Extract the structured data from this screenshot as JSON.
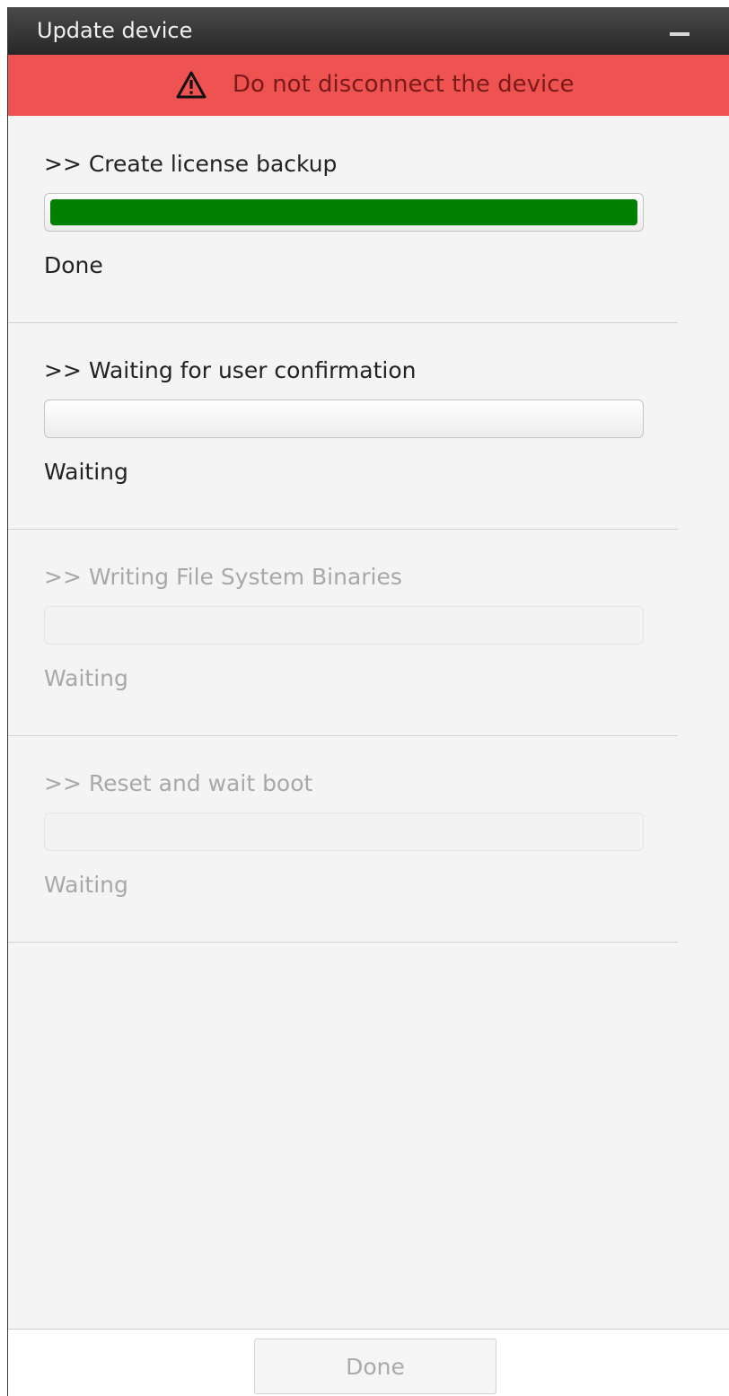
{
  "window": {
    "title": "Update device",
    "minimize_icon": "minimize-icon"
  },
  "banner": {
    "icon": "warning-triangle-icon",
    "text": "Do not disconnect the device",
    "background_color": "#ee5351"
  },
  "steps": [
    {
      "title": ">> Create license backup",
      "progress": 1.0,
      "status": "Done",
      "state": "completed"
    },
    {
      "title": ">> Waiting for user confirmation",
      "progress": 0.0,
      "status": "Waiting",
      "state": "active"
    },
    {
      "title": ">> Writing File System Binaries",
      "progress": 0.0,
      "status": "Waiting",
      "state": "pending"
    },
    {
      "title": ">> Reset and wait boot",
      "progress": 0.0,
      "status": "Waiting",
      "state": "pending"
    }
  ],
  "progress_color": "#008000",
  "footer": {
    "done_label": "Done",
    "done_enabled": false
  }
}
